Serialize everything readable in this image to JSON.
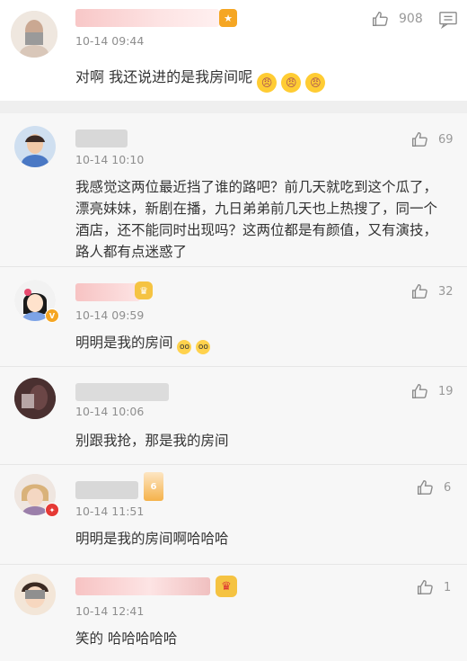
{
  "comments": [
    {
      "time": "10-14 09:44",
      "text": "对啊 我还说进的是我房间呢",
      "likes": "908"
    },
    {
      "time": "10-14 10:10",
      "text": "我感觉这两位最近挡了谁的路吧？前几天就吃到这个瓜了，漂亮妹妹，新剧在播，九日弟弟前几天也上热搜了，同一个酒店，还不能同时出现吗？这两位都是有颜值，又有演技，路人都有点迷惑了",
      "likes": "69"
    },
    {
      "time": "10-14 09:59",
      "text": "明明是我的房间",
      "likes": "32"
    },
    {
      "time": "10-14 10:06",
      "text": "别跟我抢，那是我的房间",
      "likes": "19"
    },
    {
      "time": "10-14 11:51",
      "text": "明明是我的房间啊哈哈哈",
      "likes": "6"
    },
    {
      "time": "10-14 12:41",
      "text": "笑的 哈哈哈哈哈",
      "likes": "1"
    }
  ],
  "icons": {
    "like": "thumbs-up-icon",
    "reply": "comment-icon",
    "emoji_angry": "angry-face-emoji",
    "emoji_glasses": "nerd-face-emoji",
    "vip": "crown-icon",
    "verified": "verified-badge-icon"
  },
  "colors": {
    "accent": "#f5a623",
    "time": "#8e8e8e",
    "text": "#333333",
    "like": "#999999"
  }
}
